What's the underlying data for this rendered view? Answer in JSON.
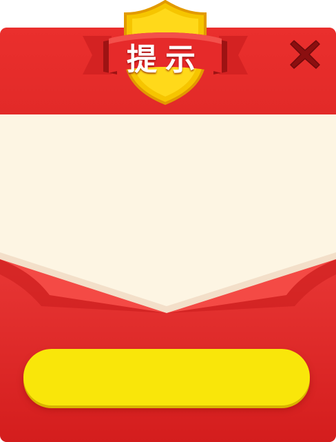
{
  "dialog": {
    "title": "提示",
    "close_icon": "close-icon",
    "message": "",
    "confirm_label": ""
  },
  "colors": {
    "dialog_red": "#e62e2e",
    "panel_cream": "#fdf5e3",
    "button_yellow": "#f9e60a",
    "shield_gold": "#f6c500",
    "close_dark_red": "#8b0f10"
  }
}
